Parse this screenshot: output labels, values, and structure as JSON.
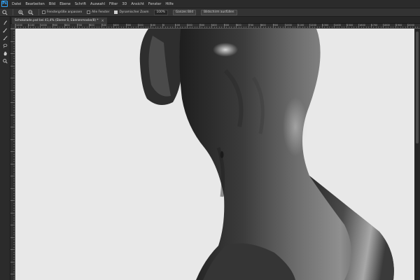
{
  "app": {
    "logo_text": "Ps",
    "menu": [
      "Datei",
      "Bearbeiten",
      "Bild",
      "Ebene",
      "Schrift",
      "Auswahl",
      "Filter",
      "3D",
      "Ansicht",
      "Fenster",
      "Hilfe"
    ]
  },
  "options": {
    "tool_icon": "zoom-tool-icon",
    "check_resize": "Fenstergröße anpassen",
    "check_all_windows": "Alle Fenster",
    "check_scrubby": "Dynamischer Zoom",
    "zoom_value": "100%",
    "btn_fit": "Ganzes Bild",
    "btn_fill": "Bildschirm ausfüllen"
  },
  "document": {
    "tab_title": "Schokolade.psd bei 41,4% (Ebene 0, Ebenenmaske/8) *",
    "close_glyph": "×"
  },
  "ruler": {
    "labels": [
      "1200",
      "1100",
      "1000",
      "900",
      "800",
      "700",
      "600",
      "500",
      "400",
      "300",
      "200",
      "100",
      "0",
      "100",
      "200",
      "300",
      "400",
      "500",
      "600",
      "700",
      "800",
      "900",
      "1000",
      "1100",
      "1200",
      "1300",
      "1400",
      "1500",
      "1600",
      "1700",
      "1800",
      "1900",
      "2000"
    ]
  },
  "colors": {
    "accent": "#31a8ff",
    "canvas_bg": "#e8e8e8",
    "ui_dark": "#2b2b2b"
  }
}
